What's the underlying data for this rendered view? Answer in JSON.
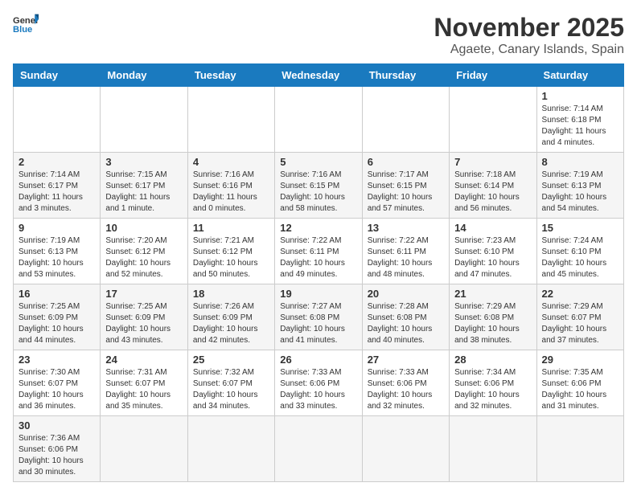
{
  "logo": {
    "text_general": "General",
    "text_blue": "Blue"
  },
  "header": {
    "month": "November 2025",
    "location": "Agaete, Canary Islands, Spain"
  },
  "weekdays": [
    "Sunday",
    "Monday",
    "Tuesday",
    "Wednesday",
    "Thursday",
    "Friday",
    "Saturday"
  ],
  "weeks": [
    [
      {
        "day": "",
        "info": ""
      },
      {
        "day": "",
        "info": ""
      },
      {
        "day": "",
        "info": ""
      },
      {
        "day": "",
        "info": ""
      },
      {
        "day": "",
        "info": ""
      },
      {
        "day": "",
        "info": ""
      },
      {
        "day": "1",
        "info": "Sunrise: 7:14 AM\nSunset: 6:18 PM\nDaylight: 11 hours\nand 4 minutes."
      }
    ],
    [
      {
        "day": "2",
        "info": "Sunrise: 7:14 AM\nSunset: 6:17 PM\nDaylight: 11 hours\nand 3 minutes."
      },
      {
        "day": "3",
        "info": "Sunrise: 7:15 AM\nSunset: 6:17 PM\nDaylight: 11 hours\nand 1 minute."
      },
      {
        "day": "4",
        "info": "Sunrise: 7:16 AM\nSunset: 6:16 PM\nDaylight: 11 hours\nand 0 minutes."
      },
      {
        "day": "5",
        "info": "Sunrise: 7:16 AM\nSunset: 6:15 PM\nDaylight: 10 hours\nand 58 minutes."
      },
      {
        "day": "6",
        "info": "Sunrise: 7:17 AM\nSunset: 6:15 PM\nDaylight: 10 hours\nand 57 minutes."
      },
      {
        "day": "7",
        "info": "Sunrise: 7:18 AM\nSunset: 6:14 PM\nDaylight: 10 hours\nand 56 minutes."
      },
      {
        "day": "8",
        "info": "Sunrise: 7:19 AM\nSunset: 6:13 PM\nDaylight: 10 hours\nand 54 minutes."
      }
    ],
    [
      {
        "day": "9",
        "info": "Sunrise: 7:19 AM\nSunset: 6:13 PM\nDaylight: 10 hours\nand 53 minutes."
      },
      {
        "day": "10",
        "info": "Sunrise: 7:20 AM\nSunset: 6:12 PM\nDaylight: 10 hours\nand 52 minutes."
      },
      {
        "day": "11",
        "info": "Sunrise: 7:21 AM\nSunset: 6:12 PM\nDaylight: 10 hours\nand 50 minutes."
      },
      {
        "day": "12",
        "info": "Sunrise: 7:22 AM\nSunset: 6:11 PM\nDaylight: 10 hours\nand 49 minutes."
      },
      {
        "day": "13",
        "info": "Sunrise: 7:22 AM\nSunset: 6:11 PM\nDaylight: 10 hours\nand 48 minutes."
      },
      {
        "day": "14",
        "info": "Sunrise: 7:23 AM\nSunset: 6:10 PM\nDaylight: 10 hours\nand 47 minutes."
      },
      {
        "day": "15",
        "info": "Sunrise: 7:24 AM\nSunset: 6:10 PM\nDaylight: 10 hours\nand 45 minutes."
      }
    ],
    [
      {
        "day": "16",
        "info": "Sunrise: 7:25 AM\nSunset: 6:09 PM\nDaylight: 10 hours\nand 44 minutes."
      },
      {
        "day": "17",
        "info": "Sunrise: 7:25 AM\nSunset: 6:09 PM\nDaylight: 10 hours\nand 43 minutes."
      },
      {
        "day": "18",
        "info": "Sunrise: 7:26 AM\nSunset: 6:09 PM\nDaylight: 10 hours\nand 42 minutes."
      },
      {
        "day": "19",
        "info": "Sunrise: 7:27 AM\nSunset: 6:08 PM\nDaylight: 10 hours\nand 41 minutes."
      },
      {
        "day": "20",
        "info": "Sunrise: 7:28 AM\nSunset: 6:08 PM\nDaylight: 10 hours\nand 40 minutes."
      },
      {
        "day": "21",
        "info": "Sunrise: 7:29 AM\nSunset: 6:08 PM\nDaylight: 10 hours\nand 38 minutes."
      },
      {
        "day": "22",
        "info": "Sunrise: 7:29 AM\nSunset: 6:07 PM\nDaylight: 10 hours\nand 37 minutes."
      }
    ],
    [
      {
        "day": "23",
        "info": "Sunrise: 7:30 AM\nSunset: 6:07 PM\nDaylight: 10 hours\nand 36 minutes."
      },
      {
        "day": "24",
        "info": "Sunrise: 7:31 AM\nSunset: 6:07 PM\nDaylight: 10 hours\nand 35 minutes."
      },
      {
        "day": "25",
        "info": "Sunrise: 7:32 AM\nSunset: 6:07 PM\nDaylight: 10 hours\nand 34 minutes."
      },
      {
        "day": "26",
        "info": "Sunrise: 7:33 AM\nSunset: 6:06 PM\nDaylight: 10 hours\nand 33 minutes."
      },
      {
        "day": "27",
        "info": "Sunrise: 7:33 AM\nSunset: 6:06 PM\nDaylight: 10 hours\nand 32 minutes."
      },
      {
        "day": "28",
        "info": "Sunrise: 7:34 AM\nSunset: 6:06 PM\nDaylight: 10 hours\nand 32 minutes."
      },
      {
        "day": "29",
        "info": "Sunrise: 7:35 AM\nSunset: 6:06 PM\nDaylight: 10 hours\nand 31 minutes."
      }
    ],
    [
      {
        "day": "30",
        "info": "Sunrise: 7:36 AM\nSunset: 6:06 PM\nDaylight: 10 hours\nand 30 minutes."
      },
      {
        "day": "",
        "info": ""
      },
      {
        "day": "",
        "info": ""
      },
      {
        "day": "",
        "info": ""
      },
      {
        "day": "",
        "info": ""
      },
      {
        "day": "",
        "info": ""
      },
      {
        "day": "",
        "info": ""
      }
    ]
  ]
}
